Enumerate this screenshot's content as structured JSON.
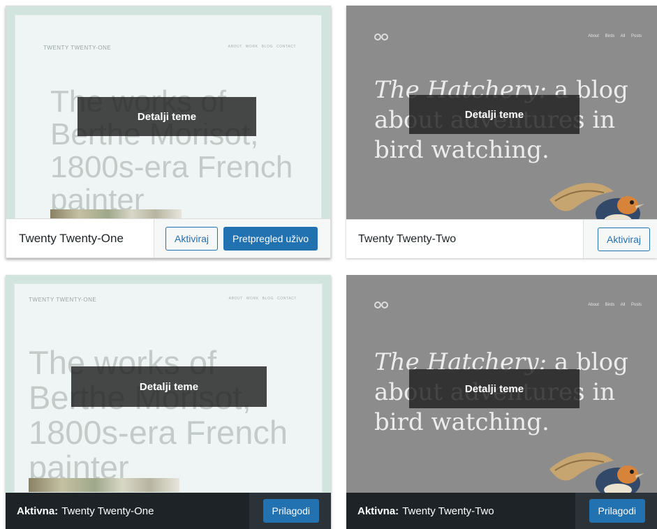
{
  "themes": [
    {
      "preview": {
        "site_title": "TWENTY TWENTY-ONE",
        "nav": "ABOUT WORK BLOG CONTACT",
        "headline": "The works of Berthe Morisot, 1800s-era French painter"
      },
      "overlay_label": "Detalji teme",
      "name": "Twenty Twenty-One",
      "activate_label": "Aktiviraj",
      "live_preview_label": "Pretpregled uživo"
    },
    {
      "preview": {
        "nav": "About Birds All Posts",
        "headline_italic": "The Hatchery:",
        "headline_rest": " a blog about adventures in bird watching."
      },
      "overlay_label": "Detalji teme",
      "name": "Twenty Twenty-Two",
      "activate_label": "Aktiviraj"
    },
    {
      "preview": {
        "site_title": "TWENTY TWENTY-ONE",
        "nav": "ABOUT WORK BLOG CONTACT",
        "headline": "The works of Berthe Morisot, 1800s-era French painter"
      },
      "overlay_label": "Detalji teme",
      "active_prefix": "Aktivna:",
      "name": "Twenty Twenty-One",
      "customize_label": "Prilagodi"
    },
    {
      "preview": {
        "nav": "About Birds All Posts",
        "headline_italic": "The Hatchery:",
        "headline_rest": " a blog about adventures in bird watching."
      },
      "overlay_label": "Detalji teme",
      "active_prefix": "Aktivna:",
      "name": "Twenty Twenty-Two",
      "customize_label": "Prilagodi"
    }
  ],
  "colors": {
    "wp_blue": "#2271b1",
    "active_bar": "#1d2327",
    "overlay": "#202020",
    "t21_background": "#eff5f4",
    "t22_background": "#8c8c8c"
  },
  "icons": [
    "twenty-twenty-two-logo-icon",
    "bird-illustration-icon"
  ]
}
